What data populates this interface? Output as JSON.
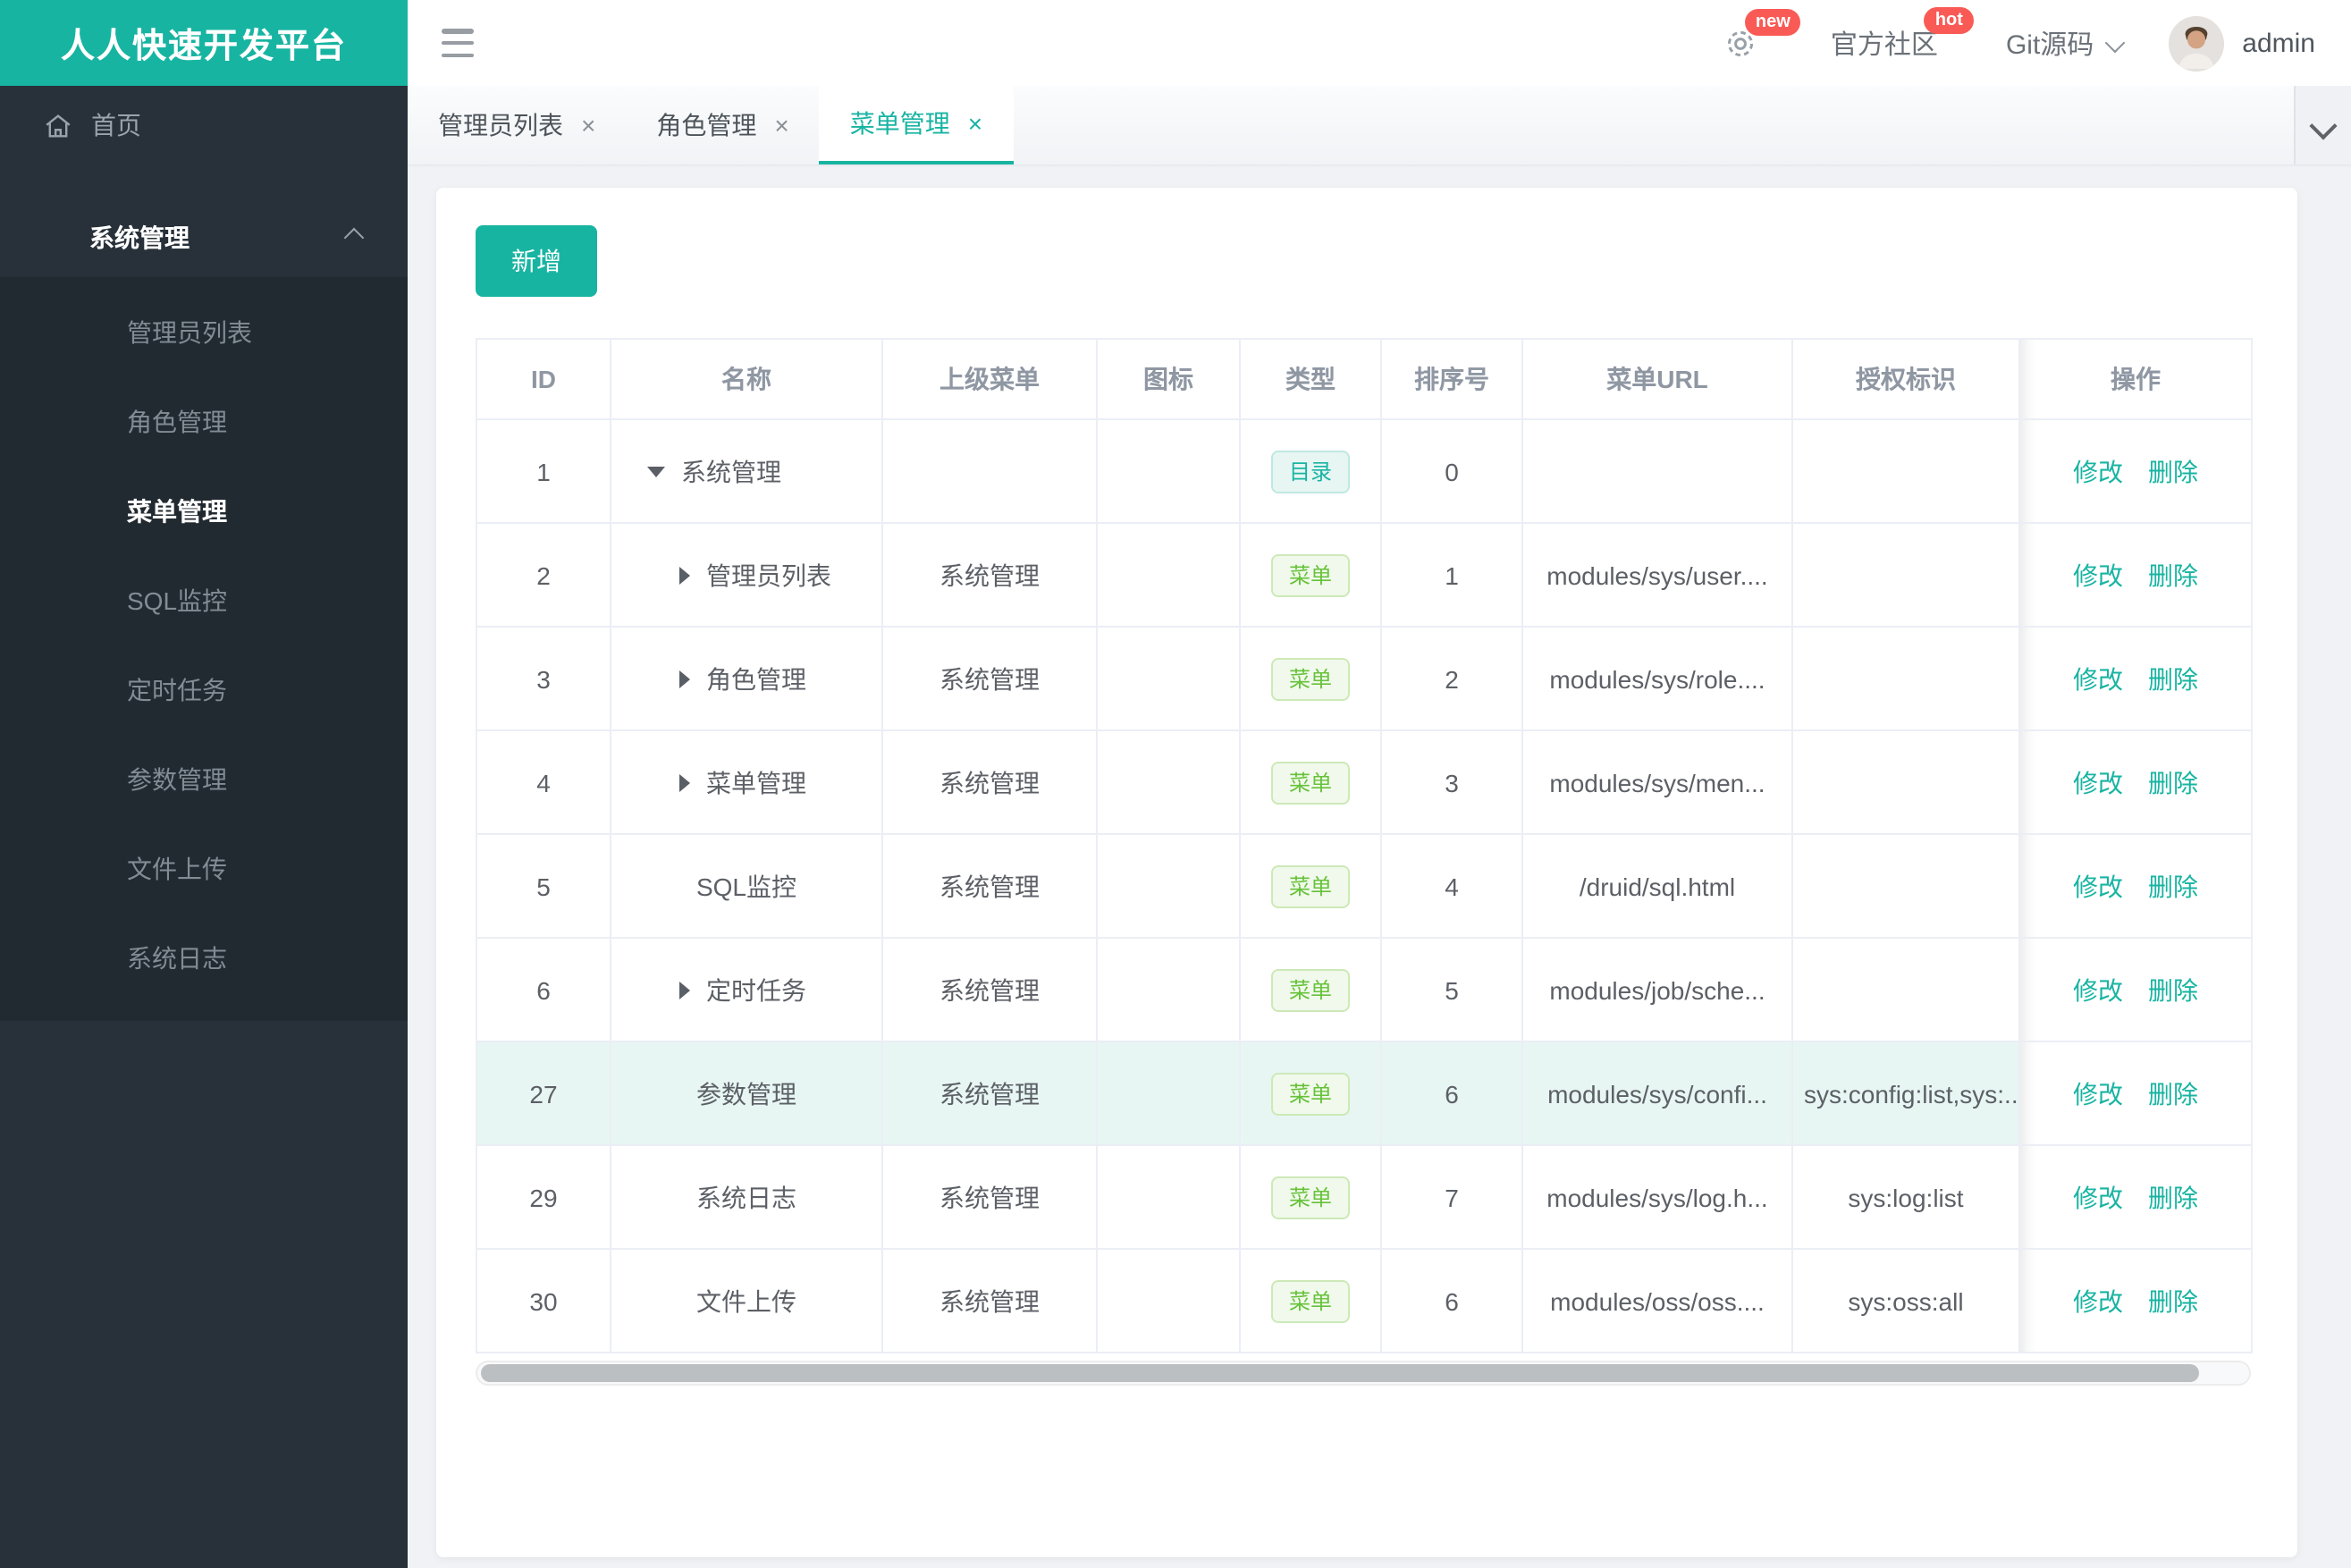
{
  "brand": {
    "title": "人人快速开发平台"
  },
  "header": {
    "settings_badge": "new",
    "community_label": "官方社区",
    "community_badge": "hot",
    "git_label": "Git源码",
    "username": "admin"
  },
  "sidebar": {
    "home_label": "首页",
    "group_label": "系统管理",
    "items": [
      {
        "label": "管理员列表",
        "active": false
      },
      {
        "label": "角色管理",
        "active": false
      },
      {
        "label": "菜单管理",
        "active": true
      },
      {
        "label": "SQL监控",
        "active": false
      },
      {
        "label": "定时任务",
        "active": false
      },
      {
        "label": "参数管理",
        "active": false
      },
      {
        "label": "文件上传",
        "active": false
      },
      {
        "label": "系统日志",
        "active": false
      }
    ]
  },
  "tabs": [
    {
      "label": "管理员列表",
      "active": false
    },
    {
      "label": "角色管理",
      "active": false
    },
    {
      "label": "菜单管理",
      "active": true
    }
  ],
  "toolbar": {
    "add_label": "新增"
  },
  "table": {
    "columns": [
      "ID",
      "名称",
      "上级菜单",
      "图标",
      "类型",
      "排序号",
      "菜单URL",
      "授权标识",
      "操作"
    ],
    "badge_labels": {
      "dir": "目录",
      "menu": "菜单"
    },
    "action_labels": {
      "edit": "修改",
      "delete": "删除"
    },
    "rows": [
      {
        "id": "1",
        "name": "系统管理",
        "expand": "down",
        "indent": 0,
        "parent": "",
        "type": "dir",
        "order": "0",
        "url": "",
        "perms": "",
        "highlight": false
      },
      {
        "id": "2",
        "name": "管理员列表",
        "expand": "right",
        "indent": 1,
        "parent": "系统管理",
        "type": "menu",
        "order": "1",
        "url": "modules/sys/user....",
        "perms": "",
        "highlight": false
      },
      {
        "id": "3",
        "name": "角色管理",
        "expand": "right",
        "indent": 1,
        "parent": "系统管理",
        "type": "menu",
        "order": "2",
        "url": "modules/sys/role....",
        "perms": "",
        "highlight": false
      },
      {
        "id": "4",
        "name": "菜单管理",
        "expand": "right",
        "indent": 1,
        "parent": "系统管理",
        "type": "menu",
        "order": "3",
        "url": "modules/sys/men...",
        "perms": "",
        "highlight": false
      },
      {
        "id": "5",
        "name": "SQL监控",
        "expand": null,
        "indent": 1,
        "parent": "系统管理",
        "type": "menu",
        "order": "4",
        "url": "/druid/sql.html",
        "perms": "",
        "highlight": false
      },
      {
        "id": "6",
        "name": "定时任务",
        "expand": "right",
        "indent": 1,
        "parent": "系统管理",
        "type": "menu",
        "order": "5",
        "url": "modules/job/sche...",
        "perms": "",
        "highlight": false
      },
      {
        "id": "27",
        "name": "参数管理",
        "expand": null,
        "indent": 1,
        "parent": "系统管理",
        "type": "menu",
        "order": "6",
        "url": "modules/sys/confi...",
        "perms": "sys:config:list,sys:...",
        "highlight": true
      },
      {
        "id": "29",
        "name": "系统日志",
        "expand": null,
        "indent": 1,
        "parent": "系统管理",
        "type": "menu",
        "order": "7",
        "url": "modules/sys/log.h...",
        "perms": "sys:log:list",
        "highlight": false
      },
      {
        "id": "30",
        "name": "文件上传",
        "expand": null,
        "indent": 1,
        "parent": "系统管理",
        "type": "menu",
        "order": "6",
        "url": "modules/oss/oss....",
        "perms": "sys:oss:all",
        "highlight": false
      }
    ]
  },
  "colors": {
    "primary": "#18b4a2",
    "badge_red": "#fa5a55",
    "tag_menu_green": "#67c23a",
    "sidebar_bg": "#28313a",
    "row_highlight": "#e7f6f3"
  }
}
